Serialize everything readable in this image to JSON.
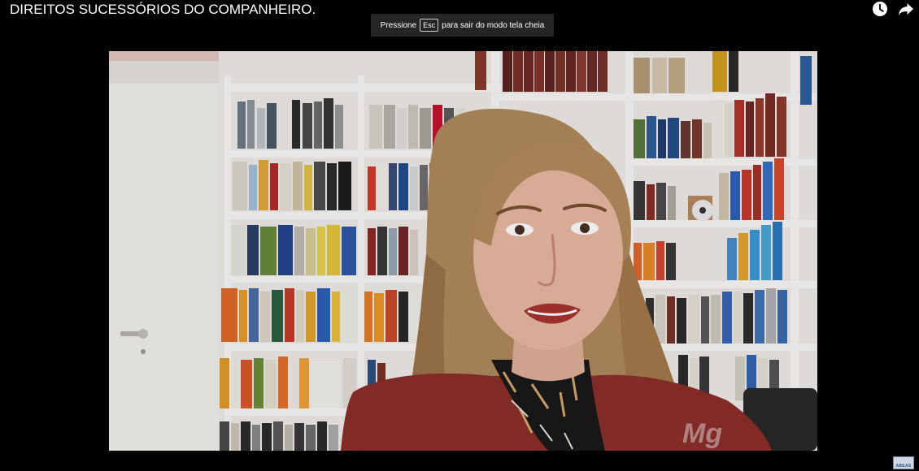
{
  "player": {
    "title": "DIREITOS SUCESSÓRIOS DO COMPANHEIRO.",
    "watch_later_icon": "clock-icon",
    "share_icon": "share-arrow-icon"
  },
  "fullscreen_notice": {
    "before": "Pressione",
    "key": "Esc",
    "after": "para sair do modo tela cheia"
  },
  "video": {
    "overlay_text": "Mg"
  },
  "channel_watermark": {
    "text": "ABEAS"
  }
}
